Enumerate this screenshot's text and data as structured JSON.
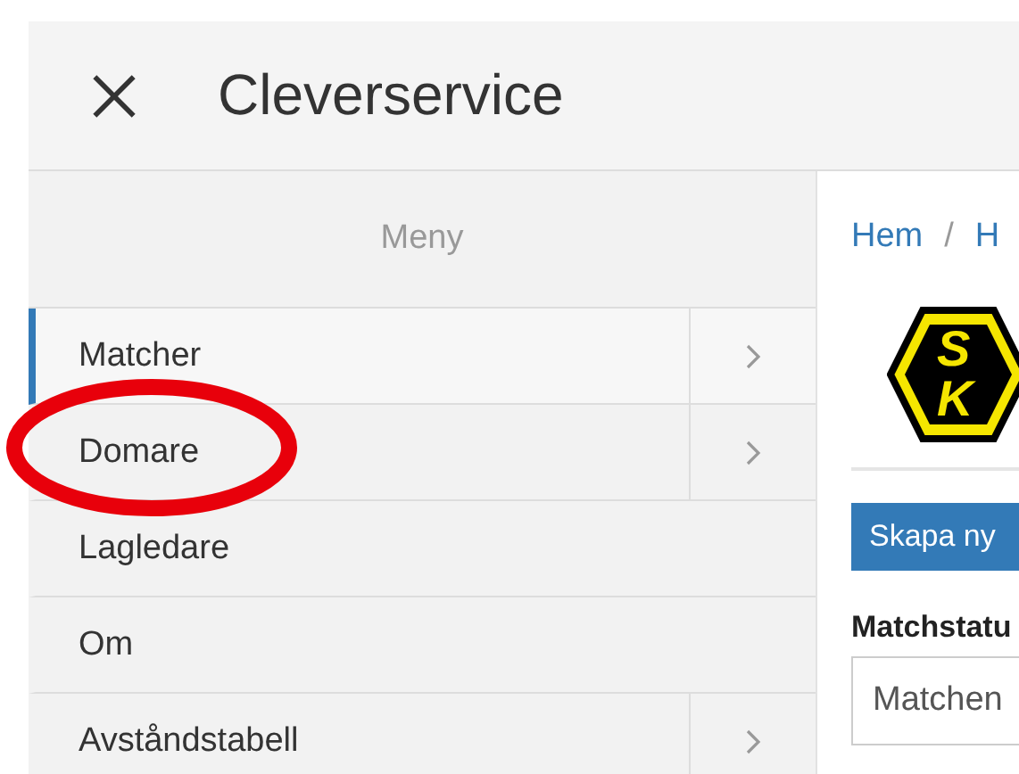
{
  "header": {
    "title": "Cleverservice"
  },
  "sidebar": {
    "heading": "Meny",
    "items": [
      {
        "label": "Matcher",
        "selected": true,
        "has_submenu": true
      },
      {
        "label": "Domare",
        "selected": false,
        "has_submenu": true
      },
      {
        "label": "Lagledare",
        "selected": false,
        "has_submenu": false
      },
      {
        "label": "Om",
        "selected": false,
        "has_submenu": false
      },
      {
        "label": "Avståndstabell",
        "selected": false,
        "has_submenu": true
      }
    ]
  },
  "content": {
    "breadcrumb": [
      "Hem",
      "H"
    ],
    "breadcrumb_separator": "/",
    "logo_letters": [
      "S",
      "K"
    ],
    "create_button": "Skapa ny",
    "status_label": "Matchstatu",
    "status_value": "Matchen"
  }
}
